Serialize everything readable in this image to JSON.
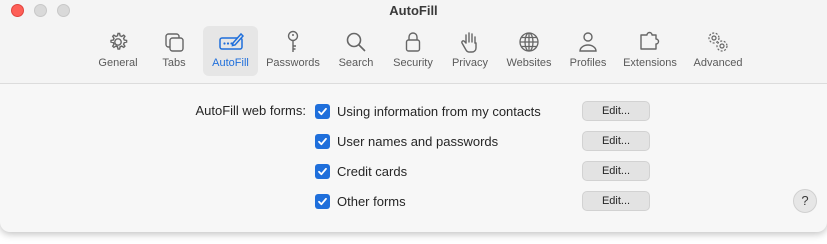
{
  "window": {
    "title": "AutoFill"
  },
  "toolbar": {
    "tabs": [
      {
        "label": "General",
        "icon": "gear-icon"
      },
      {
        "label": "Tabs",
        "icon": "tabs-icon"
      },
      {
        "label": "AutoFill",
        "icon": "autofill-pencil-icon",
        "selected": true
      },
      {
        "label": "Passwords",
        "icon": "key-icon"
      },
      {
        "label": "Search",
        "icon": "magnifier-icon"
      },
      {
        "label": "Security",
        "icon": "lock-icon"
      },
      {
        "label": "Privacy",
        "icon": "hand-icon"
      },
      {
        "label": "Websites",
        "icon": "globe-icon"
      },
      {
        "label": "Profiles",
        "icon": "person-icon"
      },
      {
        "label": "Extensions",
        "icon": "puzzle-icon"
      },
      {
        "label": "Advanced",
        "icon": "gears-icon"
      }
    ]
  },
  "autofill": {
    "label": "AutoFill web forms:",
    "options": [
      {
        "text": "Using information from my contacts",
        "checked": true,
        "edit": "Edit..."
      },
      {
        "text": "User names and passwords",
        "checked": true,
        "edit": "Edit..."
      },
      {
        "text": "Credit cards",
        "checked": true,
        "edit": "Edit..."
      },
      {
        "text": "Other forms",
        "checked": true,
        "edit": "Edit..."
      }
    ]
  },
  "help": {
    "label": "?"
  },
  "colors": {
    "accent": "#1f6fdb",
    "close": "#fe5f57"
  }
}
